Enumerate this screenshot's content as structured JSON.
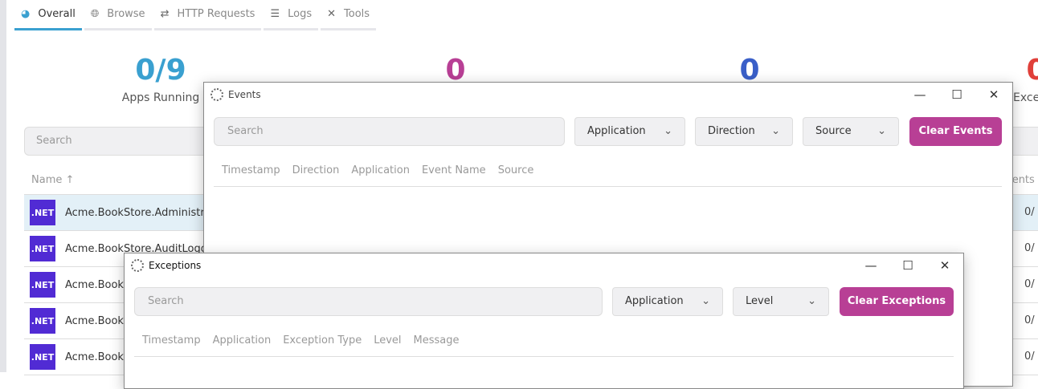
{
  "tabs": [
    {
      "label": "Overall",
      "icon": "dashboard-icon"
    },
    {
      "label": "Browse",
      "icon": "globe-icon"
    },
    {
      "label": "HTTP Requests",
      "icon": "arrows-exchange-icon"
    },
    {
      "label": "Logs",
      "icon": "list-icon"
    },
    {
      "label": "Tools",
      "icon": "tools-icon"
    }
  ],
  "stats": [
    {
      "value": "0/9",
      "label": "Apps Running",
      "color": "#3aa0d0"
    },
    {
      "value": "0",
      "label": "",
      "color": "#b83f95"
    },
    {
      "value": "0",
      "label": "",
      "color": "#3a5fc8"
    },
    {
      "value": "0",
      "label": "Exce",
      "color": "#e0403a"
    }
  ],
  "search_placeholder": "Search",
  "table": {
    "name_header": "Name ↑",
    "events_header": "vents",
    "rows": [
      {
        "badge": ".NET",
        "name": "Acme.BookStore.Administra",
        "value": "0/"
      },
      {
        "badge": ".NET",
        "name": "Acme.BookStore.AuditLogg",
        "value": "0/"
      },
      {
        "badge": ".NET",
        "name": "Acme.BookS",
        "value": "0/"
      },
      {
        "badge": ".NET",
        "name": "Acme.BookS",
        "value": "0/"
      },
      {
        "badge": ".NET",
        "name": "Acme.BookS",
        "value": "0/"
      }
    ]
  },
  "events": {
    "title": "Events",
    "search_placeholder": "Search",
    "dropdowns": [
      "Application",
      "Direction",
      "Source"
    ],
    "clear_label": "Clear Events",
    "columns": [
      "Timestamp",
      "Direction",
      "Application",
      "Event Name",
      "Source"
    ]
  },
  "exceptions": {
    "title": "Exceptions",
    "search_placeholder": "Search",
    "dropdowns": [
      "Application",
      "Level"
    ],
    "clear_label": "Clear Exceptions",
    "columns": [
      "Timestamp",
      "Application",
      "Exception Type",
      "Level",
      "Message"
    ]
  },
  "window_controls": {
    "minimize": "—",
    "maximize": "☐",
    "close": "✕"
  }
}
